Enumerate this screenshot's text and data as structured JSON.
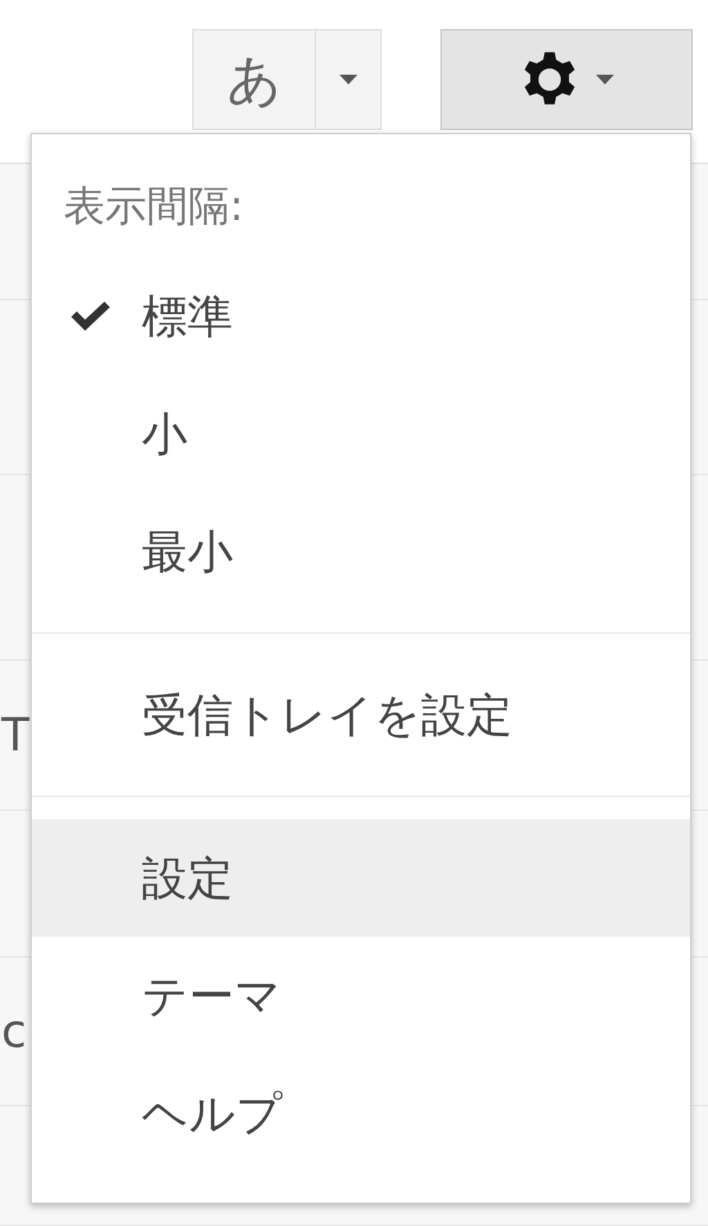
{
  "toolbar": {
    "input_tools_button": {
      "label": "あ"
    },
    "settings_button": {
      "expanded": true
    }
  },
  "background_rows": [
    {},
    {},
    {},
    {
      "text": "T"
    },
    {},
    {
      "text": "c"
    },
    {}
  ],
  "settings_menu": {
    "sections": [
      {
        "header": "表示間隔:",
        "items": [
          {
            "label": "標準",
            "kind": "option",
            "selected": true,
            "highlighted": false
          },
          {
            "label": "小",
            "kind": "option",
            "selected": false,
            "highlighted": false
          },
          {
            "label": "最小",
            "kind": "option",
            "selected": false,
            "highlighted": false
          }
        ]
      },
      {
        "items": [
          {
            "label": "受信トレイを設定",
            "kind": "action",
            "highlighted": false
          }
        ]
      },
      {
        "items": [
          {
            "label": "設定",
            "kind": "action",
            "highlighted": true
          },
          {
            "label": "テーマ",
            "kind": "action",
            "highlighted": false
          },
          {
            "label": "ヘルプ",
            "kind": "action",
            "highlighted": false
          }
        ]
      }
    ]
  }
}
